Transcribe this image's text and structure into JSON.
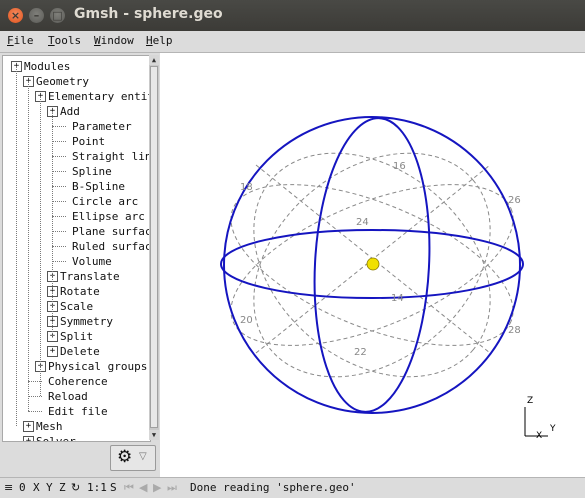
{
  "window": {
    "title": "Gmsh - sphere.geo"
  },
  "menubar": {
    "items": [
      "File",
      "Tools",
      "Window",
      "Help"
    ]
  },
  "tree": [
    {
      "label": "Modules",
      "box": "+",
      "level": 0
    },
    {
      "label": "Geometry",
      "box": "+",
      "level": 1
    },
    {
      "label": "Elementary entities",
      "box": "+",
      "level": 2
    },
    {
      "label": "Add",
      "box": "+",
      "level": 3
    },
    {
      "label": "Parameter",
      "box": "",
      "level": 4
    },
    {
      "label": "Point",
      "box": "",
      "level": 4
    },
    {
      "label": "Straight line",
      "box": "",
      "level": 4
    },
    {
      "label": "Spline",
      "box": "",
      "level": 4
    },
    {
      "label": "B-Spline",
      "box": "",
      "level": 4
    },
    {
      "label": "Circle arc",
      "box": "",
      "level": 4
    },
    {
      "label": "Ellipse arc",
      "box": "",
      "level": 4
    },
    {
      "label": "Plane surface",
      "box": "",
      "level": 4
    },
    {
      "label": "Ruled surface",
      "box": "",
      "level": 4
    },
    {
      "label": "Volume",
      "box": "",
      "level": 4
    },
    {
      "label": "Translate",
      "box": "+",
      "level": 3
    },
    {
      "label": "Rotate",
      "box": "+",
      "level": 3
    },
    {
      "label": "Scale",
      "box": "+",
      "level": 3
    },
    {
      "label": "Symmetry",
      "box": "+",
      "level": 3
    },
    {
      "label": "Split",
      "box": "+",
      "level": 3
    },
    {
      "label": "Delete",
      "box": "+",
      "level": 3
    },
    {
      "label": "Physical groups",
      "box": "+",
      "level": 2
    },
    {
      "label": "Coherence",
      "box": "",
      "level": 2
    },
    {
      "label": "Reload",
      "box": "",
      "level": 2
    },
    {
      "label": "Edit file",
      "box": "",
      "level": 2
    },
    {
      "label": "Mesh",
      "box": "+",
      "level": 1
    },
    {
      "label": "Solver",
      "box": "+",
      "level": 1
    }
  ],
  "graphics": {
    "surface_labels": [
      "16",
      "18",
      "26",
      "24",
      "14",
      "20",
      "28",
      "22"
    ],
    "axes_labels": {
      "z": "Z",
      "y": "Y",
      "x": "X"
    },
    "colors": {
      "curve": "#1515c0",
      "dashed": "#8a8a8a",
      "point": "#f0e000"
    }
  },
  "statusbar": {
    "buttons": [
      "0",
      "X",
      "Y",
      "Z",
      "1:1",
      "S"
    ],
    "message": "Done reading 'sphere.geo'"
  }
}
